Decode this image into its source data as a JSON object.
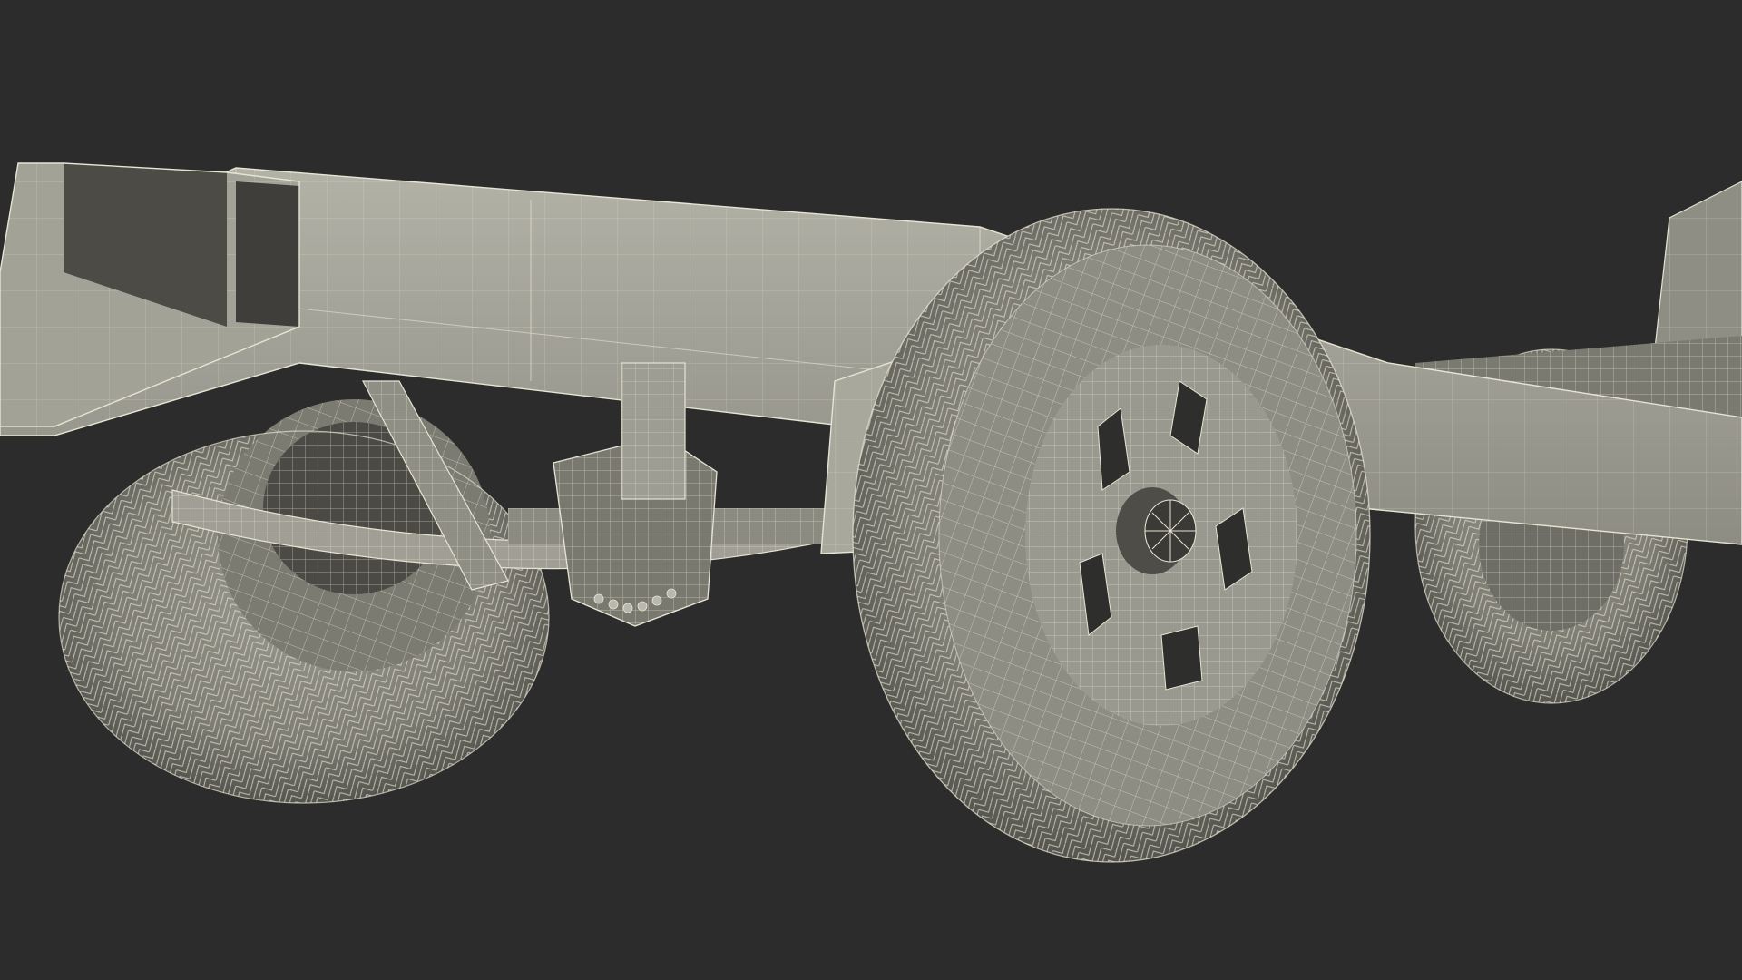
{
  "viewport": {
    "background": "#2c2c2c",
    "render_mode": "wireframe-on-shaded",
    "subject": "truck-chassis",
    "colors": {
      "surface_light": "#aaa99e",
      "surface_mid": "#8f8e84",
      "surface_dark": "#5d5c55",
      "surface_shadow": "#3f3e3a",
      "wire": "#e6e4d2",
      "wire_faint": "#c9c7b6"
    },
    "parts": [
      {
        "name": "frame-rail"
      },
      {
        "name": "front-crossmember"
      },
      {
        "name": "rear-left-wheel"
      },
      {
        "name": "rear-axle"
      },
      {
        "name": "leaf-spring"
      },
      {
        "name": "differential"
      },
      {
        "name": "mud-flap"
      },
      {
        "name": "front-right-wheel"
      },
      {
        "name": "front-left-wheel"
      },
      {
        "name": "front-axle"
      },
      {
        "name": "front-bumper"
      }
    ]
  }
}
